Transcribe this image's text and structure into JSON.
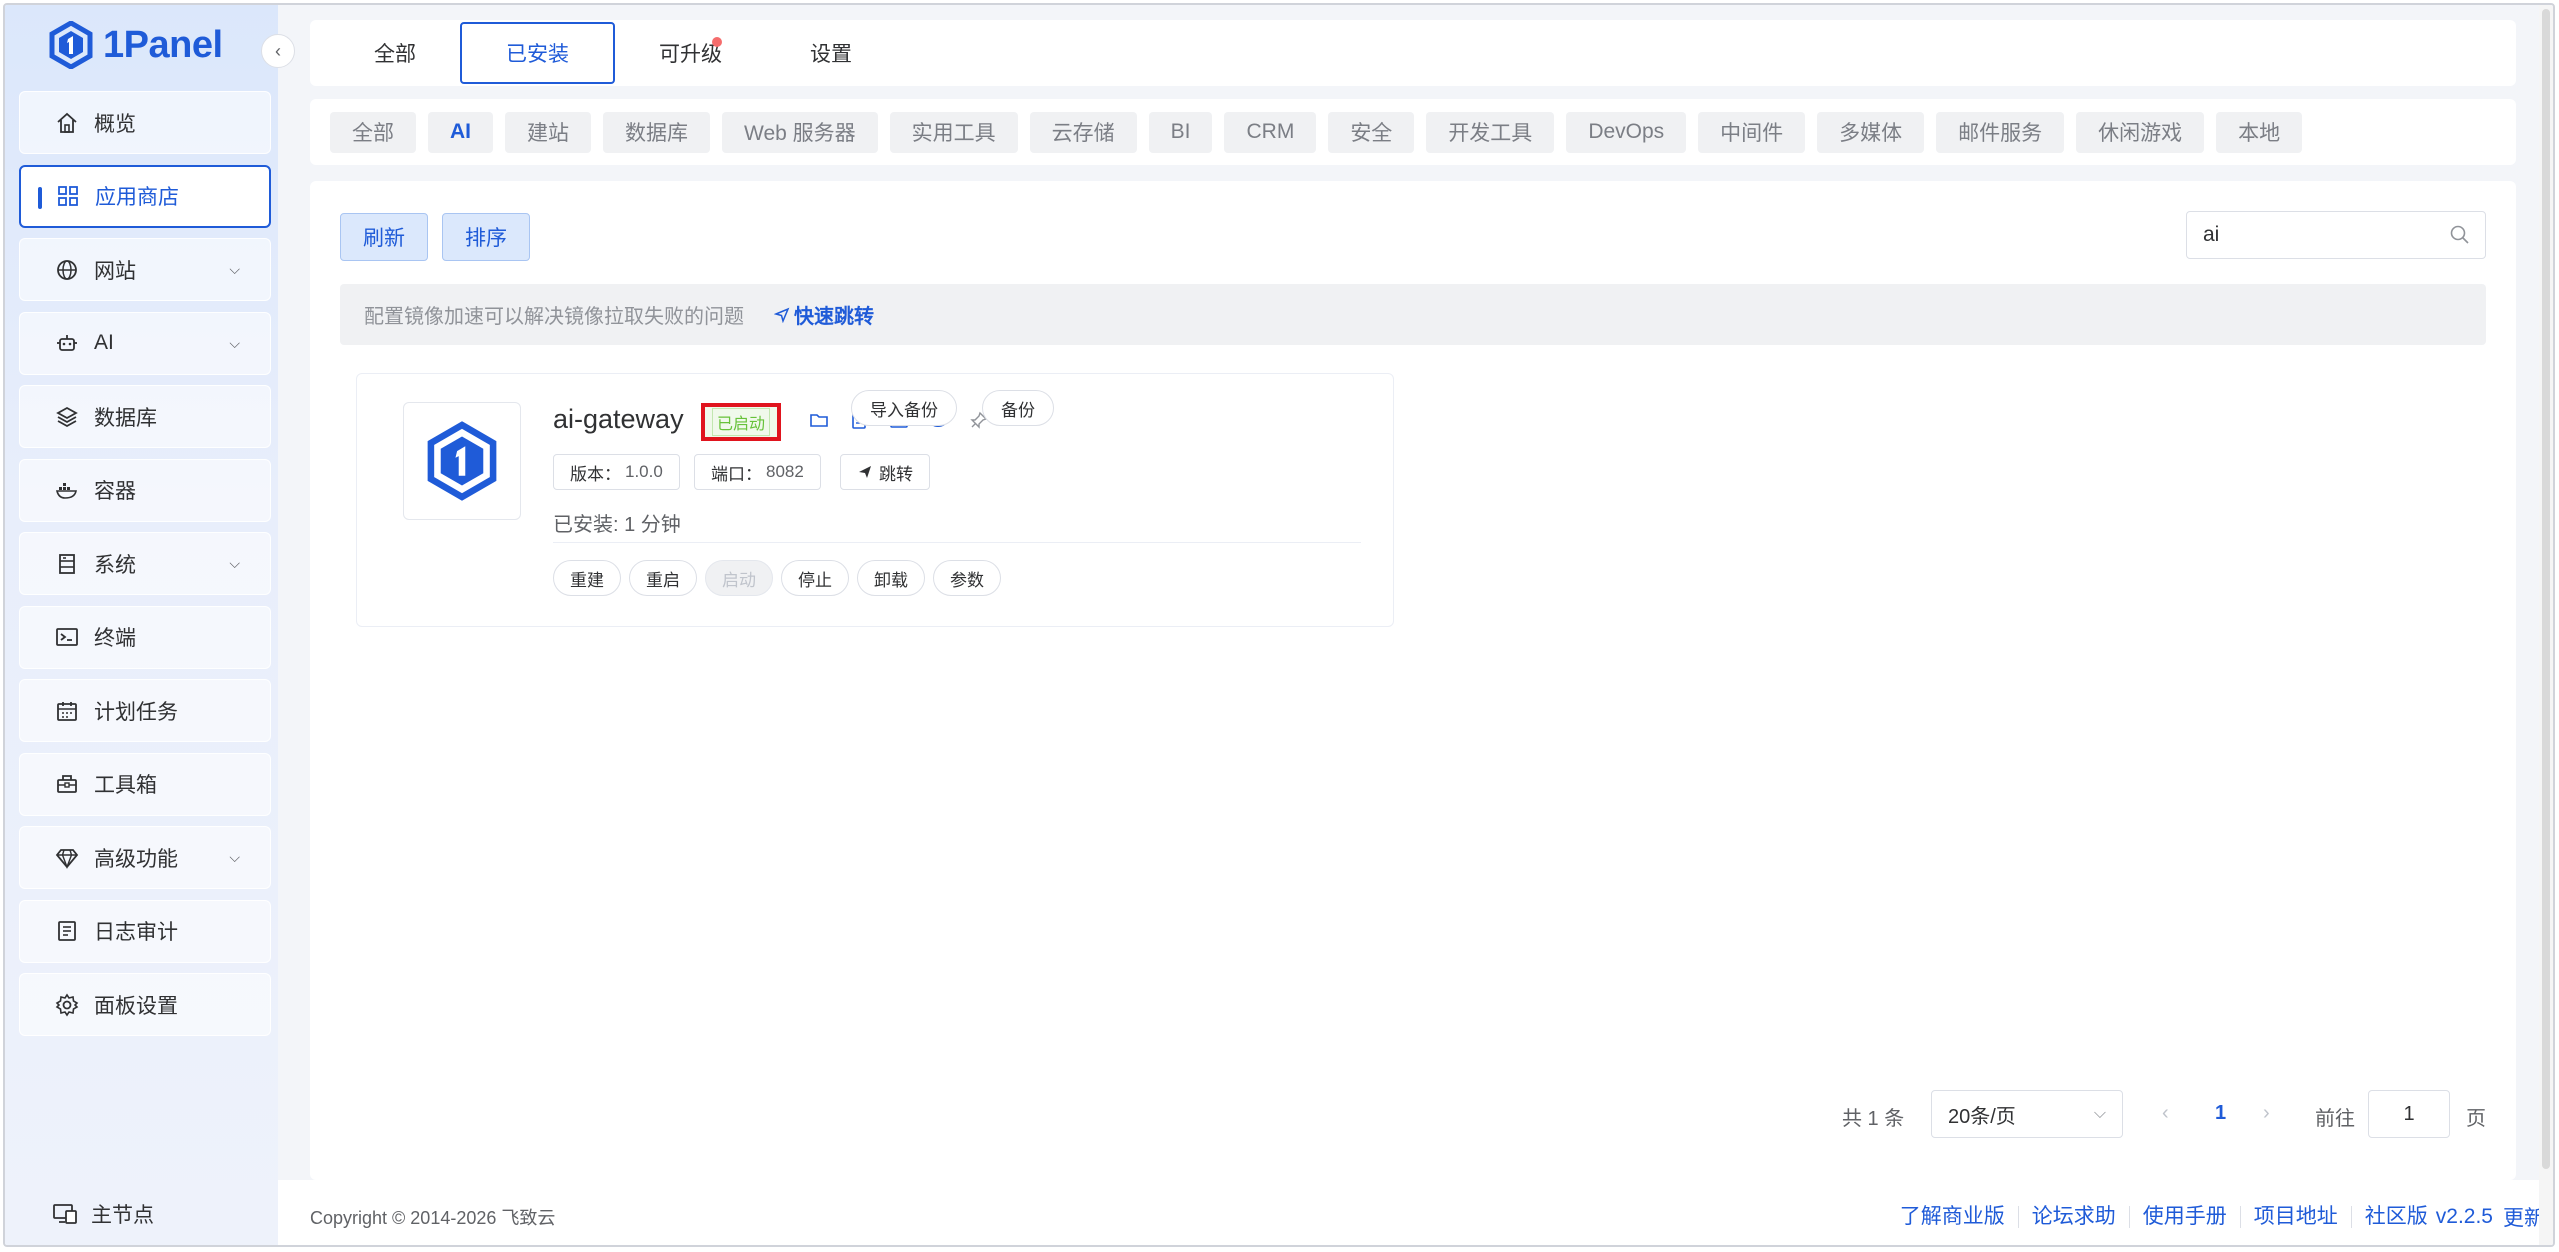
{
  "brand": {
    "name": "1Panel"
  },
  "sidebar": {
    "items": [
      {
        "label": "概览",
        "icon": "home-icon",
        "chevron": false,
        "active": false
      },
      {
        "label": "应用商店",
        "icon": "apps-grid-icon",
        "chevron": false,
        "active": true
      },
      {
        "label": "网站",
        "icon": "globe-icon",
        "chevron": true,
        "active": false
      },
      {
        "label": "AI",
        "icon": "robot-icon",
        "chevron": true,
        "active": false
      },
      {
        "label": "数据库",
        "icon": "layers-icon",
        "chevron": false,
        "active": false
      },
      {
        "label": "容器",
        "icon": "docker-icon",
        "chevron": false,
        "active": false
      },
      {
        "label": "系统",
        "icon": "server-icon",
        "chevron": true,
        "active": false
      },
      {
        "label": "终端",
        "icon": "terminal-icon",
        "chevron": false,
        "active": false
      },
      {
        "label": "计划任务",
        "icon": "calendar-icon",
        "chevron": false,
        "active": false
      },
      {
        "label": "工具箱",
        "icon": "toolbox-icon",
        "chevron": false,
        "active": false
      },
      {
        "label": "高级功能",
        "icon": "diamond-icon",
        "chevron": true,
        "active": false
      },
      {
        "label": "日志审计",
        "icon": "log-icon",
        "chevron": false,
        "active": false
      },
      {
        "label": "面板设置",
        "icon": "gear-icon",
        "chevron": false,
        "active": false
      }
    ],
    "master_node": "主节点"
  },
  "topbar": {
    "tabs": [
      {
        "label": "全部",
        "active": false,
        "dot": false
      },
      {
        "label": "已安装",
        "active": true,
        "dot": false
      },
      {
        "label": "可升级",
        "active": false,
        "dot": true
      },
      {
        "label": "设置",
        "active": false,
        "dot": false
      }
    ]
  },
  "categories": [
    "全部",
    "AI",
    "建站",
    "数据库",
    "Web 服务器",
    "实用工具",
    "云存储",
    "BI",
    "CRM",
    "安全",
    "开发工具",
    "DevOps",
    "中间件",
    "多媒体",
    "邮件服务",
    "休闲游戏",
    "本地"
  ],
  "active_category": "AI",
  "toolbar": {
    "refresh_label": "刷新",
    "sort_label": "排序"
  },
  "search": {
    "value": "ai"
  },
  "notice": {
    "text": "配置镜像加速可以解决镜像拉取失败的问题",
    "jump_label": "快速跳转"
  },
  "app_card": {
    "name": "ai-gateway",
    "status": "已启动",
    "import_backup_label": "导入备份",
    "backup_label": "备份",
    "version_label": "版本：",
    "version_value": "1.0.0",
    "port_label": "端口：",
    "port_value": "8082",
    "jump_label": "跳转",
    "installed_text": "已安装:  1 分钟",
    "actions": [
      {
        "label": "重建",
        "disabled": false
      },
      {
        "label": "重启",
        "disabled": false
      },
      {
        "label": "启动",
        "disabled": true
      },
      {
        "label": "停止",
        "disabled": false
      },
      {
        "label": "卸载",
        "disabled": false
      },
      {
        "label": "参数",
        "disabled": false
      }
    ]
  },
  "pagination": {
    "total_text": "共 1 条",
    "page_size": "20条/页",
    "current_page": "1",
    "goto_label": "前往",
    "goto_value": "1",
    "page_suffix": "页"
  },
  "footer": {
    "copyright": "Copyright © 2014-2026 飞致云",
    "links": [
      "了解商业版",
      "论坛求助",
      "使用手册",
      "项目地址",
      "社区版"
    ],
    "version": "v2.2.5",
    "update_label": "更新"
  },
  "colors": {
    "accent": "#1f5bd8",
    "status_running": "#67c23a",
    "highlight_box": "#e0141e",
    "upgrade_dot": "#f56c6c"
  }
}
